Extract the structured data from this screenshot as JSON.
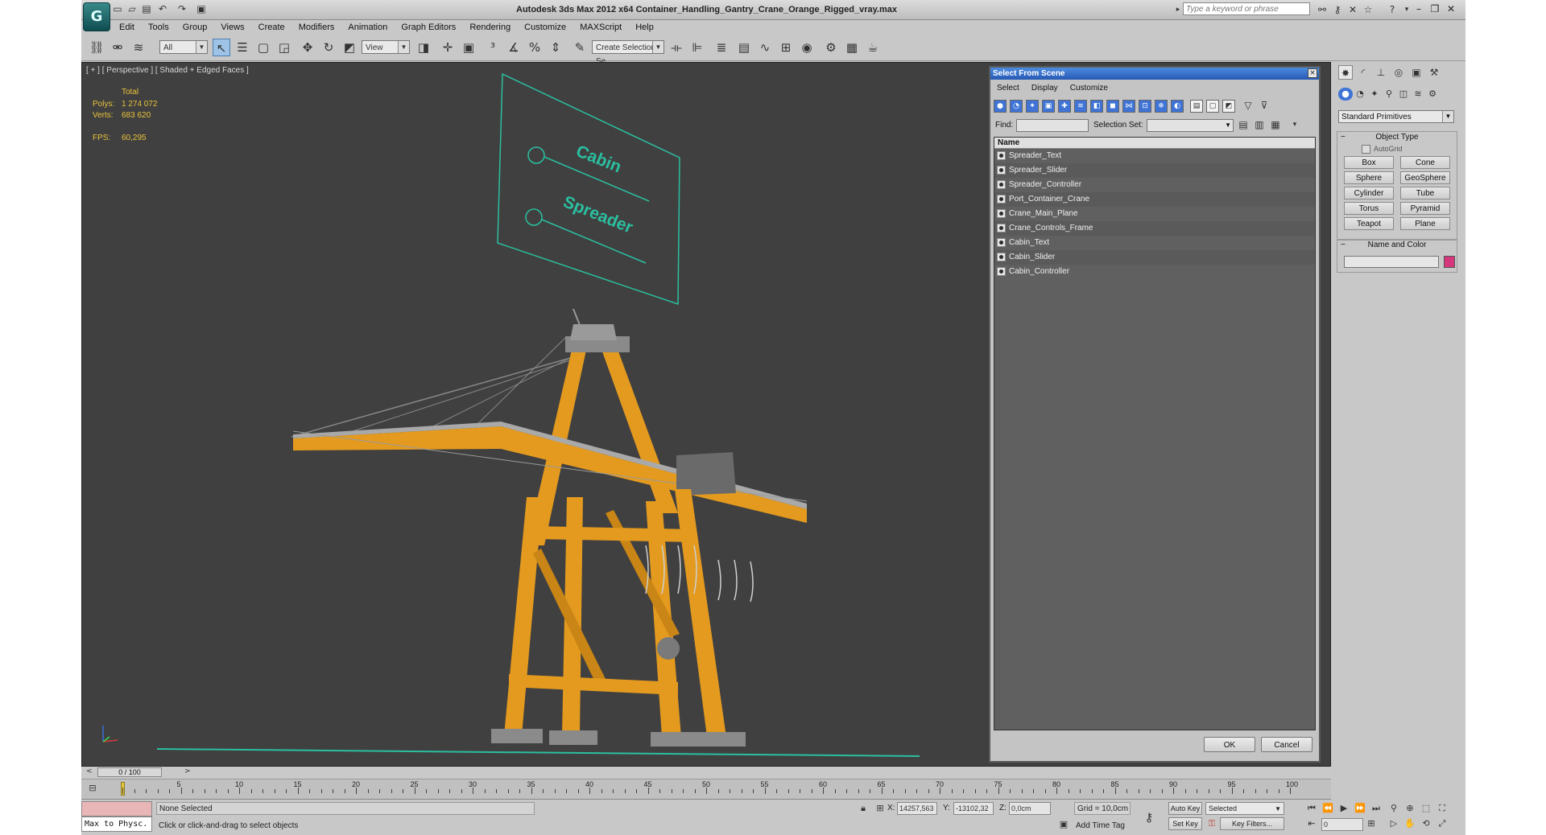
{
  "titlebar": {
    "logo": "G",
    "title": "Autodesk 3ds Max  2012 x64      Container_Handling_Gantry_Crane_Orange_Rigged_vray.max",
    "search_placeholder": "Type a keyword or phrase"
  },
  "menu": [
    "Edit",
    "Tools",
    "Group",
    "Views",
    "Create",
    "Modifiers",
    "Animation",
    "Graph Editors",
    "Rendering",
    "Customize",
    "MAXScript",
    "Help"
  ],
  "toolbar": {
    "filter_value": "All",
    "coord_value": "View",
    "selection_set_placeholder": "Create Selection Se"
  },
  "viewport": {
    "label": "[ + ] [ Perspective ] [ Shaded + Edged Faces ]",
    "stats": {
      "total_label": "Total",
      "polys_label": "Polys:",
      "polys_value": "1 274 072",
      "verts_label": "Verts:",
      "verts_value": "683 620",
      "fps_label": "FPS:",
      "fps_value": "60,295"
    },
    "controls_panel": {
      "cabin_label": "Cabin",
      "spreader_label": "Spreader"
    }
  },
  "dialog": {
    "title": "Select From Scene",
    "close": "×",
    "menu": [
      "Select",
      "Display",
      "Customize"
    ],
    "find_label": "Find:",
    "selection_set_label": "Selection Set:",
    "column_name": "Name",
    "items": [
      "Spreader_Text",
      "Spreader_Slider",
      "Spreader_Controller",
      "Port_Container_Crane",
      "Crane_Main_Plane",
      "Crane_Controls_Frame",
      "Cabin_Text",
      "Cabin_Slider",
      "Cabin_Controller"
    ],
    "ok_label": "OK",
    "cancel_label": "Cancel"
  },
  "command_panel": {
    "category": "Standard Primitives",
    "object_type_title": "Object Type",
    "autogrid_label": "AutoGrid",
    "buttons": [
      "Box",
      "Cone",
      "Sphere",
      "GeoSphere",
      "Cylinder",
      "Tube",
      "Torus",
      "Pyramid",
      "Teapot",
      "Plane"
    ],
    "name_color_title": "Name and Color",
    "color": "#d4377c"
  },
  "timeline": {
    "frame_display": "0 / 100",
    "ticks": [
      "5",
      "10",
      "15",
      "20",
      "25",
      "30",
      "35",
      "40",
      "45",
      "50",
      "55",
      "60",
      "65",
      "70",
      "75",
      "80",
      "85",
      "90",
      "95",
      "100"
    ]
  },
  "status": {
    "script_listener": "Max to Physc.",
    "selection": "None Selected",
    "prompt": "Click or click-and-drag to select objects",
    "x_label": "X:",
    "x_value": "14257,563",
    "y_label": "Y:",
    "y_value": "-13102,32",
    "z_label": "Z:",
    "z_value": "0,0cm",
    "grid": "Grid = 10,0cm",
    "add_time_tag": "Add Time Tag",
    "auto_key": "Auto Key",
    "selected": "Selected",
    "set_key": "Set Key",
    "key_filters": "Key Filters...",
    "frame_value": "0"
  }
}
